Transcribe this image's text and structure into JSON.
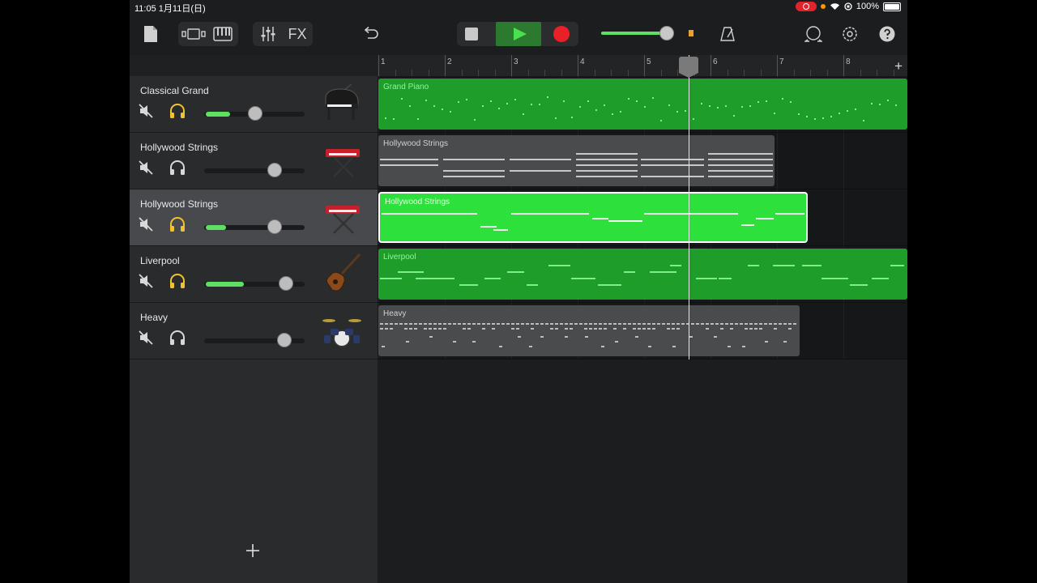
{
  "status": {
    "time": "11:05",
    "date": "1月11日(日)",
    "battery": "100%"
  },
  "toolbar": {
    "fx_label": "FX",
    "icons": [
      "my-songs-icon",
      "browser-icon",
      "keyboard-icon",
      "mixer-icon",
      "undo-icon",
      "stop-icon",
      "play-icon",
      "record-icon",
      "metronome-icon",
      "loop-icon",
      "settings-icon",
      "help-icon"
    ],
    "master_volume": 0.92,
    "colors": {
      "play": "#2c7a30",
      "record": "#ea1f28",
      "accent": "#5ee062"
    }
  },
  "ruler": {
    "bars": [
      "1",
      "2",
      "3",
      "4",
      "5",
      "6",
      "7",
      "8"
    ],
    "add_label": "+"
  },
  "tracks": [
    {
      "name": "Classical Grand",
      "icon": "grand-piano-icon",
      "solo_active": true,
      "level": 0.24,
      "volume": 0.5
    },
    {
      "name": "Hollywood Strings",
      "icon": "keyboard-stand-icon",
      "solo_active": false,
      "level": 0.0,
      "volume": 0.69
    },
    {
      "name": "Hollywood Strings",
      "icon": "keyboard-stand-icon",
      "solo_active": true,
      "level": 0.2,
      "volume": 0.69,
      "selected": true
    },
    {
      "name": "Liverpool",
      "icon": "bass-guitar-icon",
      "solo_active": true,
      "level": 0.38,
      "volume": 0.81
    },
    {
      "name": "Heavy",
      "icon": "drum-kit-icon",
      "solo_active": false,
      "level": 0.0,
      "volume": 0.79
    }
  ],
  "regions": [
    {
      "label": "Grand Piano",
      "color": "#1f9d2b",
      "label_color": "#8ff59a"
    },
    {
      "label": "Hollywood Strings",
      "color": "#4a4b4d",
      "label_color": "#d0d0d0"
    },
    {
      "label": "Hollywood Strings",
      "color": "#2ee03c",
      "label_color": "#e8ffe8"
    },
    {
      "label": "Liverpool",
      "color": "#1f9d2b",
      "label_color": "#8ff59a"
    },
    {
      "label": "Heavy",
      "color": "#4a4b4d",
      "label_color": "#d0d0d0"
    }
  ],
  "add_track_label": "+"
}
